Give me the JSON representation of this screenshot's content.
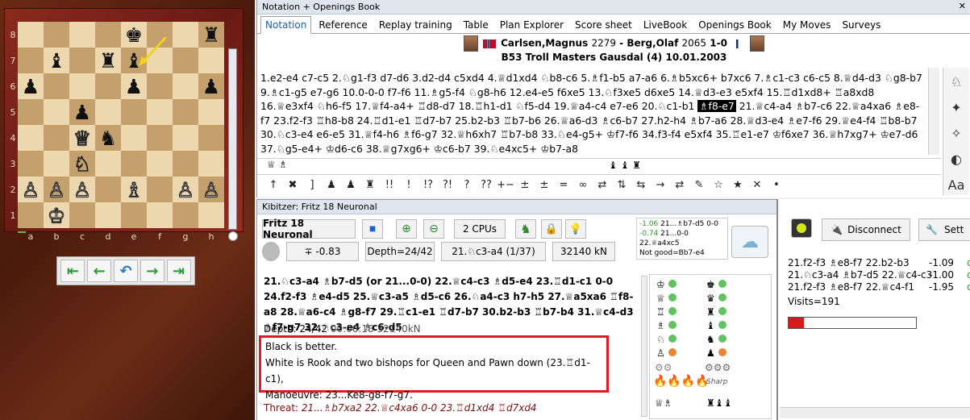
{
  "board": {
    "ranks": [
      "8",
      "7",
      "6",
      "5",
      "4",
      "3",
      "2",
      "1"
    ],
    "files": [
      "a",
      "b",
      "c",
      "d",
      "e",
      "f",
      "g",
      "h"
    ],
    "pieces": [
      [
        "",
        "",
        "",
        "",
        "bk",
        "",
        "",
        "br"
      ],
      [
        "",
        "bb",
        "",
        "br",
        "bb",
        "",
        "",
        ""
      ],
      [
        "bp",
        "",
        "",
        "",
        "bp",
        "",
        "",
        "bp"
      ],
      [
        "",
        "",
        "bp",
        "",
        "",
        "",
        "",
        ""
      ],
      [
        "",
        "",
        "wq",
        "bn",
        "",
        "",
        "",
        ""
      ],
      [
        "",
        "",
        "wn",
        "",
        "",
        "",
        "",
        ""
      ],
      [
        "wp",
        "wp",
        "wp",
        "",
        "wb",
        "",
        "wp",
        "wp"
      ],
      [
        "",
        "wk",
        "",
        "",
        "",
        "",
        "",
        ""
      ]
    ],
    "nav_buttons": [
      "start-icon",
      "back-icon",
      "undo-icon",
      "forward-icon",
      "end-icon"
    ]
  },
  "notation": {
    "window_title": "Notation + Openings Book",
    "tabs": [
      "Notation",
      "Reference",
      "Replay training",
      "Table",
      "Plan Explorer",
      "Score sheet",
      "LiveBook",
      "Openings Book",
      "My Moves",
      "Surveys"
    ],
    "active_tab": 0,
    "white_player": "Carlsen,Magnus",
    "white_elo": "2279",
    "black_player": "Berg,Olaf",
    "black_elo": "2065",
    "result": "1-0",
    "event_line": "B53 Troll Masters Gausdal (4) 10.01.2003",
    "moves_before": "1.e2-e4 c7-c5 2.♘g1-f3 d7-d6 3.d2-d4 c5xd4 4.♕d1xd4 ♘b8-c6 5.♗f1-b5 a7-a6 6.♗b5xc6+ b7xc6 7.♗c1-c3 c6-c5 8.♕d4-d3 ♘g8-b7 9.♗c1-g5 e7-g6 10.0-0-0 f7-f6 11.♗g5-f4 ♘g8-h6 12.e4-e5 f6xe5 13.♘f3xe5 d6xe5 14.♕d3-e3 e5xf4 15.♖d1xd8+ ♖a8xd8 16.♕e3xf4 ♘h6-f5 17.♕f4-a4+ ♖d8-d7 18.♖h1-d1 ♘f5-d4 19.♕a4-c4 e7-e6 20.♘c1-b1",
    "current_move": "♗f8-e7",
    "moves_after": "21.♕c4-a4 ♗b7-c6 22.♕a4xa6 ♗e8-f7 23.f2-f3 ♖h8-b8 24.♖d1-e1 ♖d7-b7 25.b2-b3 ♖b7-b6 26.♕a6-d3 ♗c6-b7 27.h2-h4 ♗b7-a6 28.♕d3-e4 ♗e7-f6 29.♕e4-f4 ♖b8-b7 30.♘c3-e4 e6-e5 31.♕f4-h6 ♗f6-g7 32.♕h6xh7 ♖b7-b8 33.♘e4-g5+ ♔f7-f6 34.f3-f4 e5xf4 35.♖e1-e7 ♔f6xe7 36.♕h7xg7+ ♔e7-d6 37.♘g5-e4+ ♔d6-c6 38.♕g7xg6+ ♔c6-b7 39.♘e4xc5+ ♔b7-a8",
    "figurine_row": "♕ ♗",
    "figurine_row2": "♝ ♝ ♜",
    "symbols": [
      "↑",
      "✖",
      "]",
      "♟",
      "♟",
      "♜",
      "!!",
      "!",
      "!?",
      "?!",
      "?",
      "??",
      "+−",
      "±",
      "±",
      "=",
      "∞",
      "⇄",
      "⇅",
      "⇆",
      "→",
      "⇄",
      "✎",
      "☆",
      "★",
      "✕",
      "•"
    ],
    "right_tools": [
      "♘",
      "✦",
      "✧",
      "◐",
      "Aa"
    ]
  },
  "kibitzer": {
    "title": "Kibitzer: Fritz 18 Neuronal",
    "engine_name": "Fritz 18 Neuronal",
    "cpus": "2 CPUs",
    "eval": "∓ -0.83",
    "depth_display": "Depth=24/42",
    "current_move": "21.♘c3-a4 (1/37)",
    "speed": "32140 kN",
    "best_lines": {
      "line1_eval": "-1.06",
      "line1": "21...♗b7-d5 0-0",
      "line2_eval": "-0.74",
      "line2": "21...0-0 22.♕a4xc5",
      "note": "Not good=Bb7-e4"
    },
    "main_line": "21.♘c3-a4 ♗b7-d5 (or 21...0-0) 22.♕c4-c3 ♗d5-e4 23.♖d1-c1 0-0 24.f2-f3 ♗e4-d5 25.♕c3-a5 ♗d5-c6 26.♘a4-c3 h7-h5 27.♕a5xa6 ♖f8-a8 28.♕a6-c4 ♗g8-f7 29.♖c1-e1 ♖d7-b7 30.b2-b3 ♖b7-b4 31.♕c4-d3 ♗f7-g7 32.♘c3-e4 ♗c6-d5",
    "depth_line": "Depth: 24/42",
    "time_line": "00:00:18 32140kN",
    "assessment": [
      "Black is better.",
      "White is Rook and two bishops for Queen and Pawn down (23.♖d1-c1),",
      "Manoeuvre: 23...Ke8-g8-f7-g7."
    ],
    "threat_label": "Threat:",
    "threat": "21...♗b7xa2 22.♕c4xa6 0-0 23.♖d1xd4 ♖d7xd4",
    "sharp_label": "Sharp"
  },
  "kibitzer2": {
    "disconnect": "Disconnect",
    "settings": "Sett",
    "lines": [
      {
        "move": "21.f2-f3 ♗e8-f7 22.b2-b3",
        "eval": "-1.09",
        "side": "de"
      },
      {
        "move": "21.♘c3-a4 ♗b7-d5 22.♕c4-c3",
        "eval": "-1.00",
        "side": "de"
      },
      {
        "move": "21.f2-f3 ♗e8-f7 22.♕c4-f1",
        "eval": "-1.95",
        "side": "de"
      }
    ],
    "visits": "Visits=191",
    "progress": 0.12
  },
  "colors": {
    "highlight_red": "#e01b24",
    "board_light": "#ecd7ae",
    "board_dark": "#c4a06c"
  }
}
